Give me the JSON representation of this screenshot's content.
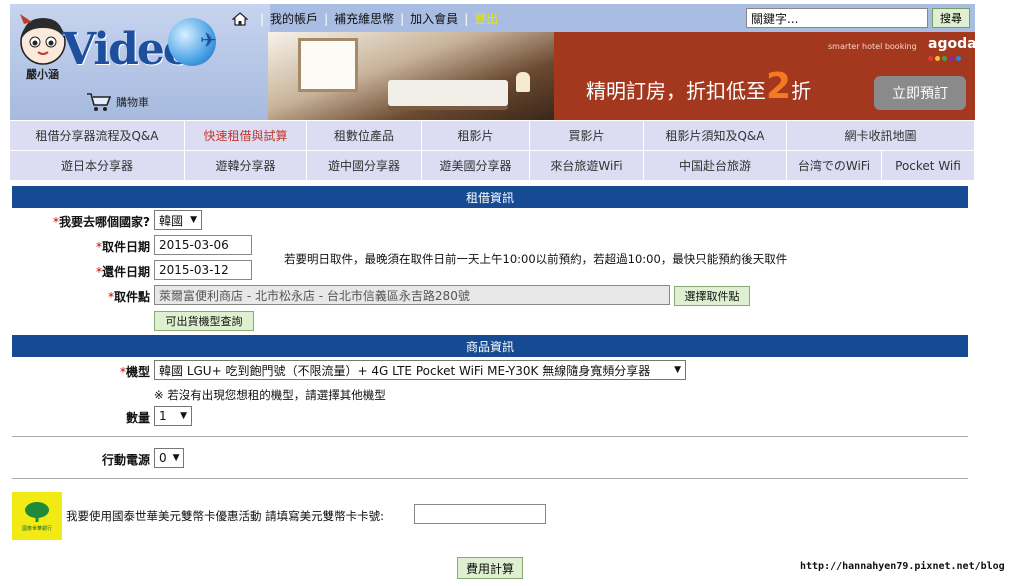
{
  "header": {
    "mascot_text": "嚴小涵",
    "logo_text": "Video",
    "cart_label": "購物車",
    "topnav": {
      "account": "我的帳戶",
      "points": "補充維思幣",
      "join": "加入會員",
      "logout": "登出"
    },
    "search": {
      "value": "關鍵字...",
      "button": "搜尋"
    },
    "banner": {
      "brand_small": "smarter hotel booking",
      "brand": "agoda",
      "slogan_pre": "精明訂房，折扣低至",
      "slogan_num": "2",
      "slogan_post": "折",
      "cta": "立即預訂"
    }
  },
  "menu": {
    "row1": [
      {
        "label": "租借分享器流程及Q&A",
        "active": false
      },
      {
        "label": "快速租借與試算",
        "active": true
      },
      {
        "label": "租數位產品",
        "active": false
      },
      {
        "label": "租影片",
        "active": false
      },
      {
        "label": "買影片",
        "active": false
      },
      {
        "label": "租影片須知及Q&A",
        "active": false
      },
      {
        "label": "網卡收訊地圖",
        "active": false
      }
    ],
    "row2": [
      {
        "label": "遊日本分享器"
      },
      {
        "label": "遊韓分享器"
      },
      {
        "label": "遊中國分享器"
      },
      {
        "label": "遊美國分享器"
      },
      {
        "label": "來台旅遊WiFi"
      },
      {
        "label": "中国赴台旅游"
      },
      {
        "label": "台湾でのWiFi"
      },
      {
        "label": "Pocket Wifi"
      }
    ]
  },
  "rental": {
    "section_title": "租借資訊",
    "country_label": "我要去哪個國家?",
    "country_value": "韓國",
    "pickup_date_label": "取件日期",
    "pickup_date_value": "2015-03-06",
    "return_date_label": "還件日期",
    "return_date_value": "2015-03-12",
    "date_note": "若要明日取件，最晚須在取件日前一天上午10:00以前預約，若超過10:00，最快只能預約後天取件",
    "pickup_point_label": "取件點",
    "pickup_point_value": "萊爾富便利商店 - 北市松永店 - 台北市信義區永吉路280號",
    "pickup_point_button": "選擇取件點",
    "availability_button": "可出貨機型查詢"
  },
  "product": {
    "section_title": "商品資訊",
    "model_label": "機型",
    "model_value": "韓國 LGU+ 吃到飽門號（不限流量）+ 4G LTE Pocket WiFi ME-Y30K 無線隨身寬頻分享器",
    "model_note": "※ 若沒有出現您想租的機型，請選擇其他機型",
    "quantity_label": "數量",
    "quantity_value": "1",
    "power_label": "行動電源",
    "power_value": "0"
  },
  "promo": {
    "bank_name": "國泰世華銀行",
    "text": "我要使用國泰世華美元雙幣卡優惠活動 請填寫美元雙幣卡卡號:",
    "card_value": ""
  },
  "calc_button": "費用計算",
  "watermark": "http://hannahyen79.pixnet.net/blog",
  "colors": {
    "header_bg": "#a9bde2",
    "menu_bg": "#dcdcf3",
    "section_bar": "#164a93",
    "banner_bg": "#a3381f",
    "accent_orange": "#f47a1f",
    "button_green": "#dff0d0"
  }
}
